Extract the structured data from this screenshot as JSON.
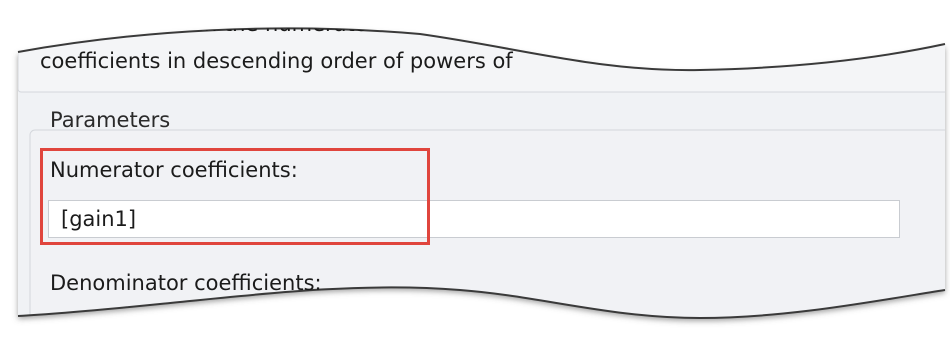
{
  "description": {
    "line1": "umber of rows in the numerato",
    "line2": "coefficients in descending order of powers of"
  },
  "parameters": {
    "legend": "Parameters",
    "numerator": {
      "label": "Numerator coefficients:",
      "value": "[gain1]"
    },
    "denominator": {
      "label": "Denominator coefficients:"
    }
  },
  "colors": {
    "panel_bg": "#f0f2f5",
    "highlight": "#e0453d",
    "torn_edge_shadow": "#555555"
  }
}
